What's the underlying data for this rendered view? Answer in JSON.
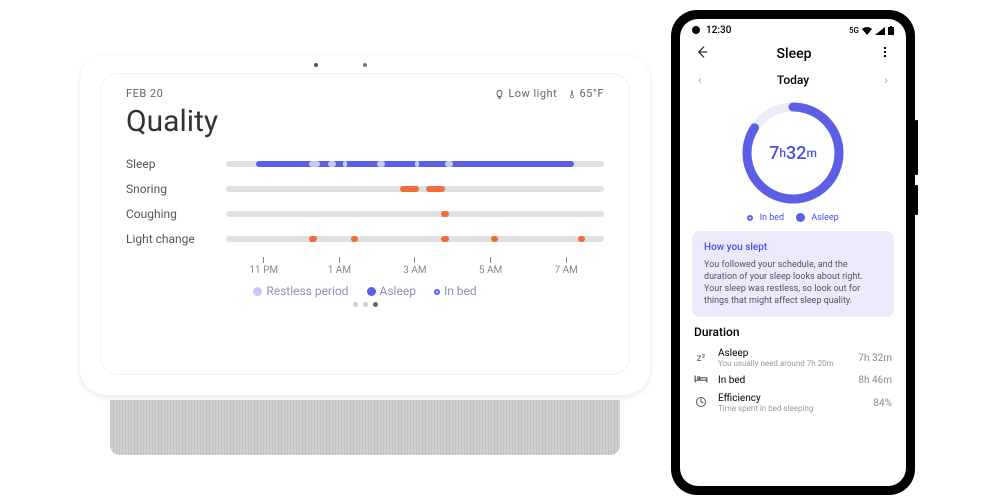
{
  "hub": {
    "date": "FEB 20",
    "light_status": "Low light",
    "temperature": "65°F",
    "title": "Quality",
    "row_labels": {
      "sleep": "Sleep",
      "snoring": "Snoring",
      "coughing": "Coughing",
      "light": "Light change"
    },
    "axis_ticks": [
      "11 PM",
      "1 AM",
      "3 AM",
      "5 AM",
      "7 AM"
    ],
    "legend": {
      "restless": "Restless period",
      "asleep": "Asleep",
      "inbed": "In bed"
    }
  },
  "phone": {
    "status": {
      "time": "12:30",
      "net": "5G"
    },
    "appbar_title": "Sleep",
    "today": "Today",
    "ring": {
      "hours": "7",
      "h": "h",
      "mins": "32",
      "m": "m"
    },
    "legend": {
      "inbed": "In bed",
      "asleep": "Asleep"
    },
    "insight": {
      "title": "How you slept",
      "body": "You followed your schedule, and the duration of your sleep looks about right. Your sleep was restless, so look out for things that might affect sleep quality."
    },
    "duration_title": "Duration",
    "rows": {
      "asleep": {
        "label": "Asleep",
        "sub": "You usually need around 7h 20m",
        "value": "7h 32m"
      },
      "inbed": {
        "label": "In bed",
        "sub": "",
        "value": "8h 46m"
      },
      "efficiency": {
        "label": "Efficiency",
        "sub": "Time spent in bed sleeping",
        "value": "84%"
      }
    }
  },
  "chart_data": {
    "type": "table",
    "title": "Sleep Quality Timeline — Feb 20",
    "x_ticks": [
      "11 PM",
      "1 AM",
      "3 AM",
      "5 AM",
      "7 AM"
    ],
    "series": [
      {
        "name": "Sleep",
        "type": "segments",
        "palette": [
          "asleep",
          "restless",
          "inbed"
        ],
        "segments_pct": [
          {
            "state": "inbed",
            "start": 0,
            "end": 8
          },
          {
            "state": "asleep",
            "start": 8,
            "end": 22
          },
          {
            "state": "restless",
            "start": 22,
            "end": 25
          },
          {
            "state": "asleep",
            "start": 25,
            "end": 40
          },
          {
            "state": "restless",
            "start": 40,
            "end": 42
          },
          {
            "state": "asleep",
            "start": 42,
            "end": 92
          },
          {
            "state": "inbed",
            "start": 92,
            "end": 100
          }
        ]
      },
      {
        "name": "Snoring",
        "type": "events",
        "color": "#f26b3a",
        "events_pct": [
          [
            46,
            51
          ],
          [
            53,
            58
          ]
        ]
      },
      {
        "name": "Coughing",
        "type": "events",
        "color": "#f26b3a",
        "events_pct": [
          [
            57,
            59
          ]
        ]
      },
      {
        "name": "Light change",
        "type": "events",
        "color": "#f26b3a",
        "events_pct": [
          [
            22,
            24
          ],
          [
            33,
            35
          ],
          [
            57,
            59
          ],
          [
            70,
            72
          ],
          [
            93,
            95
          ]
        ]
      }
    ],
    "ring": {
      "asleep_min": 452,
      "inbed_min": 526,
      "efficiency_pct": 84
    }
  }
}
